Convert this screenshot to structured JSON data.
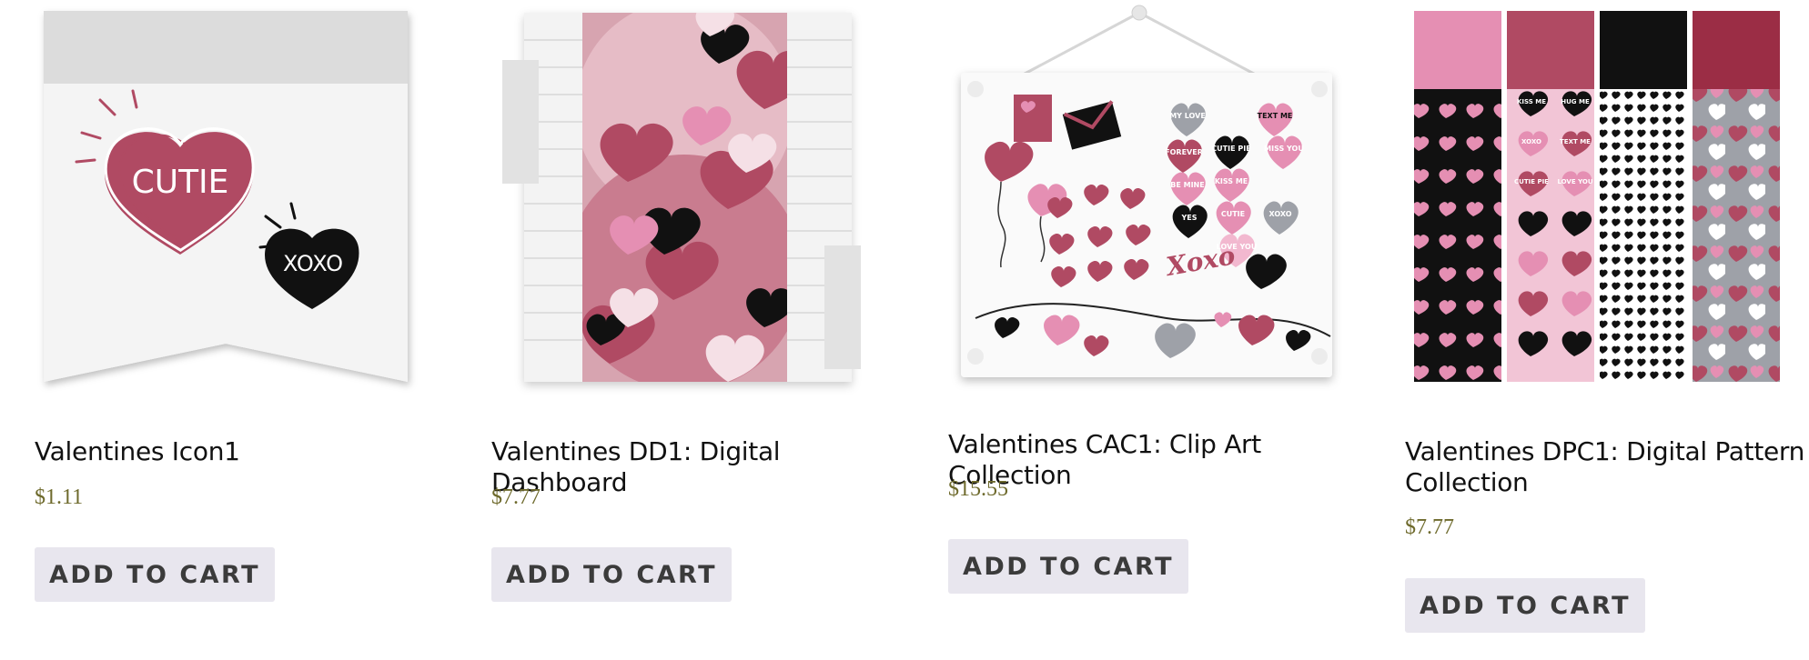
{
  "products": [
    {
      "title": "Valentines Icon1",
      "price": "$1.11",
      "button": "ADD TO CART",
      "image": {
        "heart_large": "CUTIE",
        "heart_small": "XOXO"
      }
    },
    {
      "title": "Valentines DD1: Digital Dashboard",
      "price": "$7.77",
      "button": "ADD TO CART"
    },
    {
      "title": "Valentines CAC1: Clip Art Collection",
      "price": "$15.55",
      "button": "ADD TO CART",
      "image": {
        "script_text": "Xoxo",
        "hearts": [
          "MY LOVE",
          "TEXT ME",
          "CUTIE PIE",
          "MISS YOU",
          "FOREVER",
          "KISS ME",
          "BE MINE",
          "YES",
          "CUTIE",
          "XOXO",
          "LOVE YOU",
          "SWEET HEART"
        ]
      }
    },
    {
      "title": "Valentines DPC1: Digital Pattern Collection",
      "price": "$7.77",
      "button": "ADD TO CART",
      "image": {
        "hearts": [
          "KISS ME",
          "HUG ME",
          "XOXO",
          "TEXT ME",
          "CUTIE PIE",
          "LOVE YOU"
        ]
      }
    }
  ],
  "colors": {
    "rose": "#b04a63",
    "pink": "#e58fb3",
    "black": "#111111",
    "gray": "#9ea1a8",
    "price": "#6e6a2c",
    "button_bg": "#e8e6ee"
  }
}
